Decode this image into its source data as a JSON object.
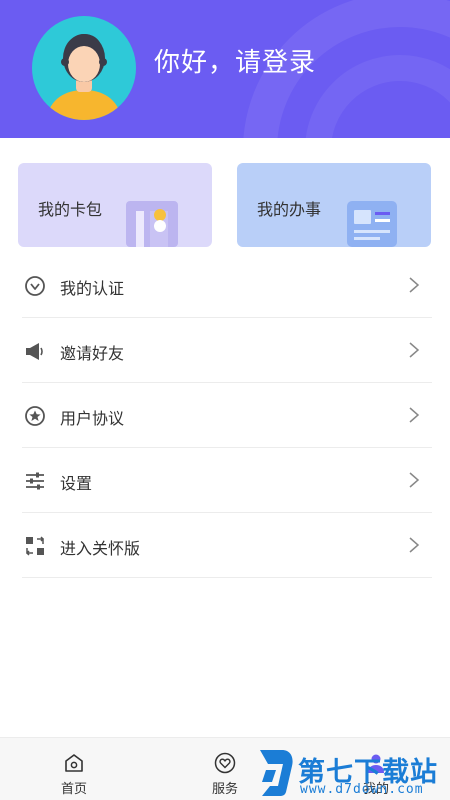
{
  "header": {
    "greeting": "你好，请登录",
    "background_color": "#6b5cf2"
  },
  "cards": [
    {
      "label": "我的卡包",
      "color": "#dcd9fa"
    },
    {
      "label": "我的办事",
      "color": "#b9cff8"
    }
  ],
  "menu": {
    "items": [
      {
        "label": "我的认证",
        "icon": "certification-icon"
      },
      {
        "label": "邀请好友",
        "icon": "megaphone-icon"
      },
      {
        "label": "用户协议",
        "icon": "star-badge-icon"
      },
      {
        "label": "设置",
        "icon": "sliders-icon"
      },
      {
        "label": "进入关怀版",
        "icon": "care-mode-icon"
      }
    ]
  },
  "tabbar": {
    "items": [
      {
        "label": "首页",
        "icon": "home-icon"
      },
      {
        "label": "服务",
        "icon": "heart-icon"
      },
      {
        "label": "我的",
        "icon": "user-icon",
        "active": true
      }
    ]
  },
  "watermark": {
    "title": "第七下载站",
    "url": "www.d7down.com"
  }
}
